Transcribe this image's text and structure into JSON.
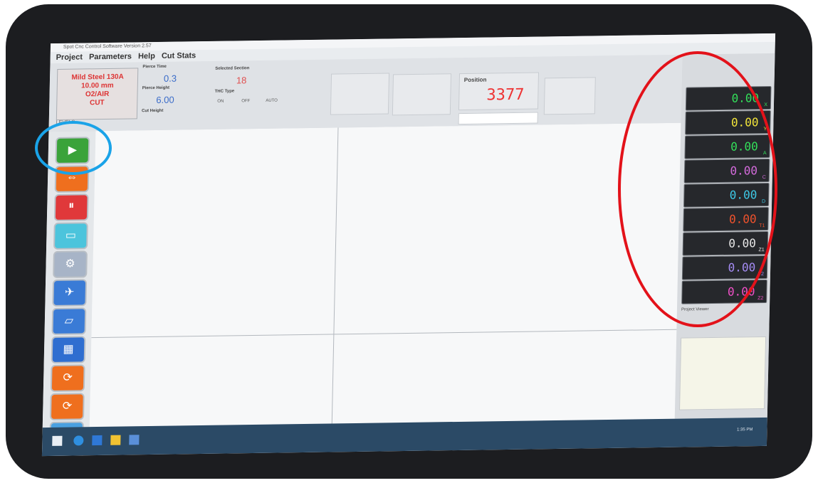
{
  "window": {
    "title": "Spot Cnc Control Software Version 2.57",
    "menu": [
      "Project",
      "Parameters",
      "Help",
      "Cut Stats"
    ]
  },
  "params": {
    "material_lines": [
      "Mild Steel 130A",
      "10.00 mm",
      "O2/AIR",
      "CUT"
    ],
    "pierce_time_label": "Pierce Time",
    "pierce_time_value": "0.3",
    "pierce_height_label": "Pierce Height",
    "pierce_height_value": "6.00",
    "cut_height_label": "Cut Height",
    "selected_section_label": "Selected Section",
    "selected_section_value": "18",
    "thc_type_label": "THC Type",
    "thc_options": [
      "ON",
      "OFF",
      "AUTO"
    ],
    "levels_label": "LEVELS"
  },
  "position": {
    "label": "Position",
    "value": "3377"
  },
  "dro": [
    {
      "value": "0.00",
      "axis": "X",
      "color": "#33e05a"
    },
    {
      "value": "0.00",
      "axis": "Y",
      "color": "#f2e53a"
    },
    {
      "value": "0.00",
      "axis": "A",
      "color": "#33e05a"
    },
    {
      "value": "0.00",
      "axis": "C",
      "color": "#d46bdc"
    },
    {
      "value": "0.00",
      "axis": "D",
      "color": "#3ec9e6"
    },
    {
      "value": "0.00",
      "axis": "T1",
      "color": "#f0522c"
    },
    {
      "value": "0.00",
      "axis": "Z1",
      "color": "#e8e8e8"
    },
    {
      "value": "0.00",
      "axis": "T2",
      "color": "#a58cf5"
    },
    {
      "value": "0.00",
      "axis": "Z2",
      "color": "#f050c8"
    }
  ],
  "preview": {
    "label": "Project Viewer"
  },
  "side_buttons": [
    {
      "name": "start-button",
      "color": "#3aa33a",
      "glyph": "▶"
    },
    {
      "name": "jog-button",
      "color": "#ef6f1e",
      "glyph": "⇔"
    },
    {
      "name": "pause-button",
      "color": "#e0383a",
      "glyph": "⏸"
    },
    {
      "name": "manual-button",
      "color": "#4cc4dc",
      "glyph": "▭"
    },
    {
      "name": "settings-button",
      "color": "#a7b4c7",
      "glyph": "⚙"
    },
    {
      "name": "torch-button",
      "color": "#3a7bd6",
      "glyph": "✈"
    },
    {
      "name": "plate-button",
      "color": "#3a7bd6",
      "glyph": "▱"
    },
    {
      "name": "layout-button",
      "color": "#2f6ed0",
      "glyph": "▦"
    },
    {
      "name": "reset-button-1",
      "color": "#ef6f1e",
      "glyph": "⟳"
    },
    {
      "name": "reset-button-2",
      "color": "#ef6f1e",
      "glyph": "⟳"
    },
    {
      "name": "image-button",
      "color": "#4aa0e0",
      "glyph": "▲"
    },
    {
      "name": "tool-button",
      "color": "#b8bec6",
      "glyph": "⌂"
    }
  ],
  "taskbar": {
    "clock": "1:35 PM"
  }
}
